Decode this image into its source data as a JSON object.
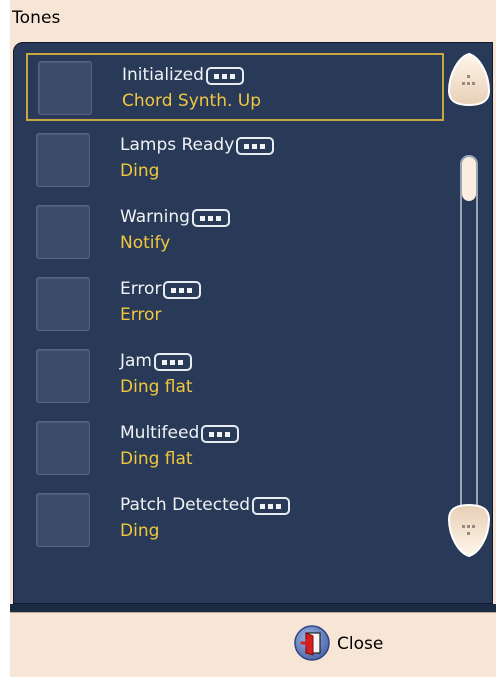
{
  "dialog": {
    "title": "Tones"
  },
  "items": [
    {
      "name": "Initialized",
      "tone": "Chord Synth. Up",
      "selected": true
    },
    {
      "name": "Lamps Ready",
      "tone": "Ding"
    },
    {
      "name": "Warning",
      "tone": "Notify"
    },
    {
      "name": "Error",
      "tone": "Error"
    },
    {
      "name": "Jam",
      "tone": "Ding flat"
    },
    {
      "name": "Multifeed",
      "tone": "Ding flat"
    },
    {
      "name": "Patch Detected",
      "tone": "Ding"
    }
  ],
  "footer": {
    "close_label": "Close"
  },
  "icons": {
    "more": "ellipsis-button-icon",
    "scroll_up": "scroll-up-arrow-icon",
    "scroll_down": "scroll-down-arrow-icon",
    "close": "exit-door-icon"
  },
  "colors": {
    "panel": "#283a57",
    "tone_text": "#f2c73f",
    "selection": "#c9a640",
    "background": "#f7e5d6"
  }
}
